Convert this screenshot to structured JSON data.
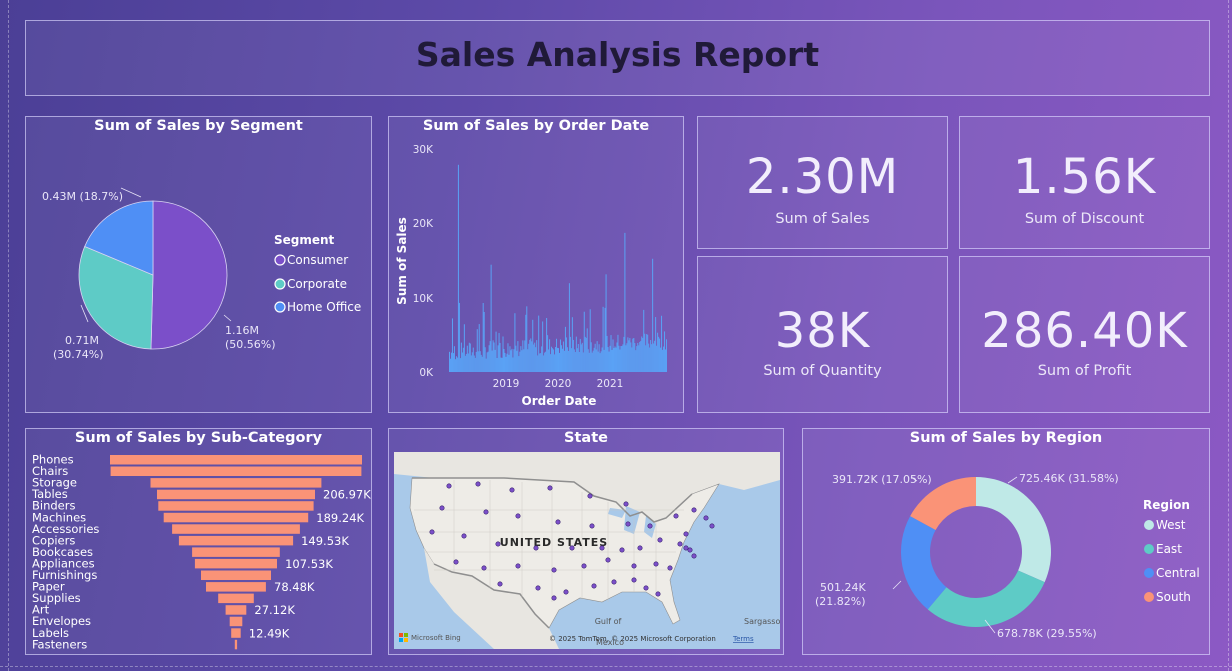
{
  "report": {
    "title": "Sales Analysis Report"
  },
  "segment": {
    "title": "Sum of Sales by Segment",
    "legend_title": "Segment",
    "legend": [
      {
        "label": "Consumer",
        "color": "#7b4fc9"
      },
      {
        "label": "Corporate",
        "color": "#5ecbc6"
      },
      {
        "label": "Home Office",
        "color": "#4f8ff5"
      }
    ],
    "labels": {
      "consumer_value": "1.16M",
      "consumer_pct": "(50.56%)",
      "corporate_value": "0.71M",
      "corporate_pct": "(30.74%)",
      "home_office": "0.43M (18.7%)"
    }
  },
  "orderdate": {
    "title": "Sum of Sales by Order Date",
    "ylabel": "Sum of Sales",
    "xlabel": "Order Date",
    "yticks": [
      "30K",
      "20K",
      "10K",
      "0K"
    ],
    "xticks": [
      "2019",
      "2020",
      "2021"
    ]
  },
  "kpis": {
    "sales": {
      "value": "2.30M",
      "label": "Sum of Sales"
    },
    "discount": {
      "value": "1.56K",
      "label": "Sum of Discount"
    },
    "quantity": {
      "value": "38K",
      "label": "Sum of Quantity"
    },
    "profit": {
      "value": "286.40K",
      "label": "Sum of Profit"
    }
  },
  "subcat": {
    "title": "Sum of Sales by Sub-Category"
  },
  "map": {
    "title": "State",
    "country": "UNITED STATES",
    "bing": "Microsoft Bing",
    "copyright": "© 2025 TomTom, © 2025 Microsoft Corporation",
    "terms": "Terms",
    "gulf": "Gulf of",
    "mexico": "Mexico",
    "sargasso": "Sargasso"
  },
  "region": {
    "title": "Sum of Sales by Region",
    "legend_title": "Region",
    "legend": [
      {
        "label": "West",
        "color": "#bfe9e7"
      },
      {
        "label": "East",
        "color": "#5ecbc6"
      },
      {
        "label": "Central",
        "color": "#4f8ff5"
      },
      {
        "label": "South",
        "color": "#fa9377"
      }
    ],
    "labels": {
      "west": "725.46K (31.58%)",
      "east": "678.78K (29.55%)",
      "central_value": "501.24K",
      "central_pct": "(21.82%)",
      "south": "391.72K (17.05%)"
    }
  },
  "chart_data": [
    {
      "type": "pie",
      "title": "Sum of Sales by Segment",
      "categories": [
        "Consumer",
        "Corporate",
        "Home Office"
      ],
      "values": [
        1.16,
        0.71,
        0.43
      ],
      "percent": [
        50.56,
        30.74,
        18.7
      ],
      "unit": "M"
    },
    {
      "type": "bar",
      "title": "Sum of Sales by Order Date",
      "xlabel": "Order Date",
      "ylabel": "Sum of Sales",
      "ylim": [
        0,
        30000
      ],
      "x_range": [
        "2018-01",
        "2021-12"
      ],
      "peaks": [
        {
          "x": "2018-03",
          "y": 28000
        },
        {
          "x": "2018-10",
          "y": 14500
        },
        {
          "x": "2020-03",
          "y": 12000
        },
        {
          "x": "2020-11",
          "y": 13200
        },
        {
          "x": "2021-03",
          "y": 18800
        },
        {
          "x": "2021-09",
          "y": 15300
        }
      ]
    },
    {
      "type": "bar",
      "orientation": "horizontal",
      "title": "Sum of Sales by Sub-Category",
      "categories": [
        "Phones",
        "Chairs",
        "Storage",
        "Tables",
        "Binders",
        "Machines",
        "Accessories",
        "Copiers",
        "Bookcases",
        "Appliances",
        "Furnishings",
        "Paper",
        "Supplies",
        "Art",
        "Envelopes",
        "Labels",
        "Fasteners"
      ],
      "values": [
        330010,
        328450,
        223840,
        206970,
        203410,
        189240,
        167380,
        149530,
        114880,
        107530,
        91710,
        78480,
        46670,
        27120,
        16480,
        12490,
        3020
      ],
      "data_labels": {
        "Tables": "206.97K",
        "Machines": "189.24K",
        "Copiers": "149.53K",
        "Appliances": "107.53K",
        "Paper": "78.48K",
        "Art": "27.12K",
        "Labels": "12.49K"
      }
    },
    {
      "type": "pie",
      "variant": "donut",
      "title": "Sum of Sales by Region",
      "categories": [
        "West",
        "East",
        "Central",
        "South"
      ],
      "values": [
        725460,
        678780,
        501240,
        391720
      ],
      "percent": [
        31.58,
        29.55,
        21.82,
        17.05
      ]
    }
  ]
}
